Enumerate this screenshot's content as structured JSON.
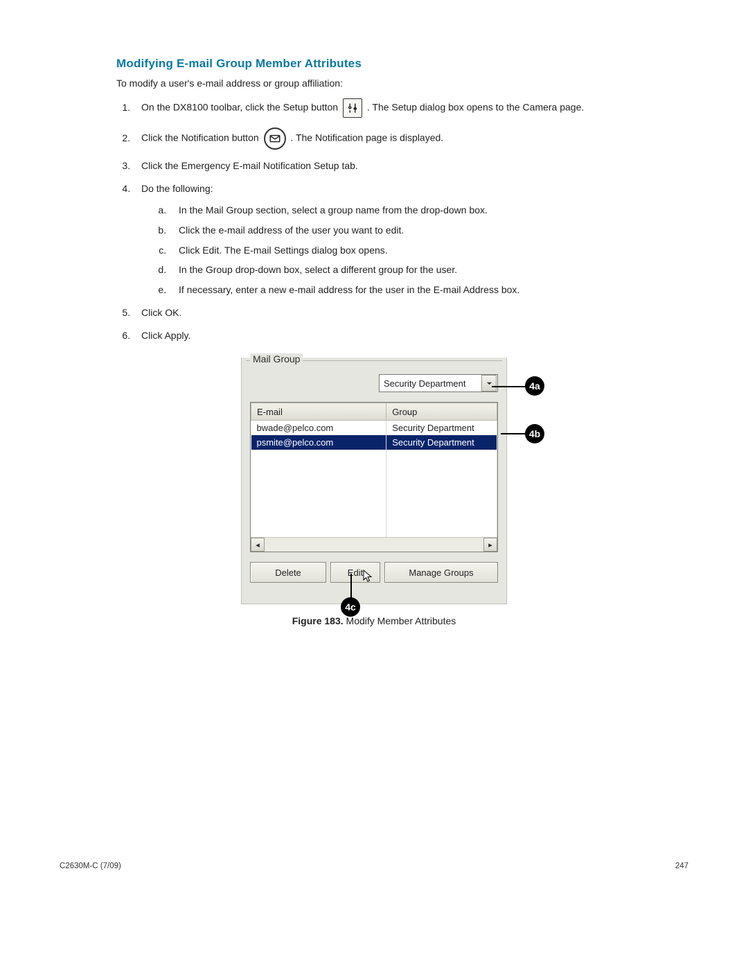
{
  "heading": "Modifying E-mail Group Member Attributes",
  "intro": "To modify a user's e-mail address or group affiliation:",
  "steps": {
    "s1a": "On the DX8100 toolbar, click the Setup button ",
    "s1b": ". The Setup dialog box opens to the Camera page.",
    "s2a": "Click the Notification button ",
    "s2b": ". The Notification page is displayed.",
    "s3": "Click the Emergency E-mail Notification Setup tab.",
    "s4": "Do the following:",
    "s4a": "In the Mail Group section, select a group name from the drop-down box.",
    "s4b": "Click the e-mail address of the user you want to edit.",
    "s4c": "Click Edit. The E-mail Settings dialog box opens.",
    "s4d": "In the Group drop-down box, select a different group for the user.",
    "s4e": "If necessary, enter a new e-mail address for the user in the E-mail Address box.",
    "s5": "Click OK.",
    "s6": "Click Apply."
  },
  "panel": {
    "legend": "Mail Group",
    "dropdown_value": "Security Department",
    "col_email": "E-mail",
    "col_group": "Group",
    "rows": [
      {
        "email": "bwade@pelco.com",
        "group": "Security Department"
      },
      {
        "email": "psmite@pelco.com",
        "group": "Security Department"
      }
    ],
    "btn_delete": "Delete",
    "btn_edit": "Edit",
    "btn_manage": "Manage Groups"
  },
  "callouts": {
    "a": "4a",
    "b": "4b",
    "c": "4c"
  },
  "caption_label": "Figure 183.",
  "caption_text": "  Modify Member Attributes",
  "footer_left": "C2630M-C (7/09)",
  "footer_right": "247"
}
